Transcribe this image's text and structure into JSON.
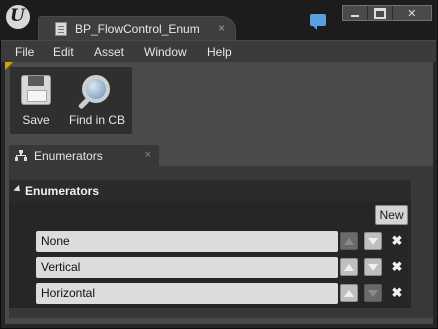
{
  "titlebar": {
    "document_tab": "BP_FlowControl_Enum",
    "close_glyph": "×",
    "icons": {
      "logo": "unreal-engine-logo-icon",
      "logo_glyph": "U",
      "tab": "blueprint-enum-icon",
      "feedback": "speech-bubble-icon"
    },
    "window_controls": {
      "close_glyph": "✕"
    }
  },
  "menu": {
    "items": [
      "File",
      "Edit",
      "Asset",
      "Window",
      "Help"
    ]
  },
  "toolbar": {
    "save_label": "Save",
    "find_label": "Find in CB",
    "icons": {
      "save": "floppy-disk-icon",
      "find": "magnifier-icon"
    }
  },
  "panel": {
    "tab_label": "Enumerators",
    "tab_close_glyph": "×",
    "category_label": "Enumerators",
    "new_button": "New",
    "entries": [
      {
        "name": "None",
        "up_enabled": false,
        "down_enabled": true
      },
      {
        "name": "Vertical",
        "up_enabled": true,
        "down_enabled": true
      },
      {
        "name": "Horizontal",
        "up_enabled": true,
        "down_enabled": false
      }
    ],
    "delete_glyph": "✖"
  },
  "colors": {
    "accent_corner": "#d6a000",
    "background": "#262626",
    "field": "#dcdcdc"
  }
}
